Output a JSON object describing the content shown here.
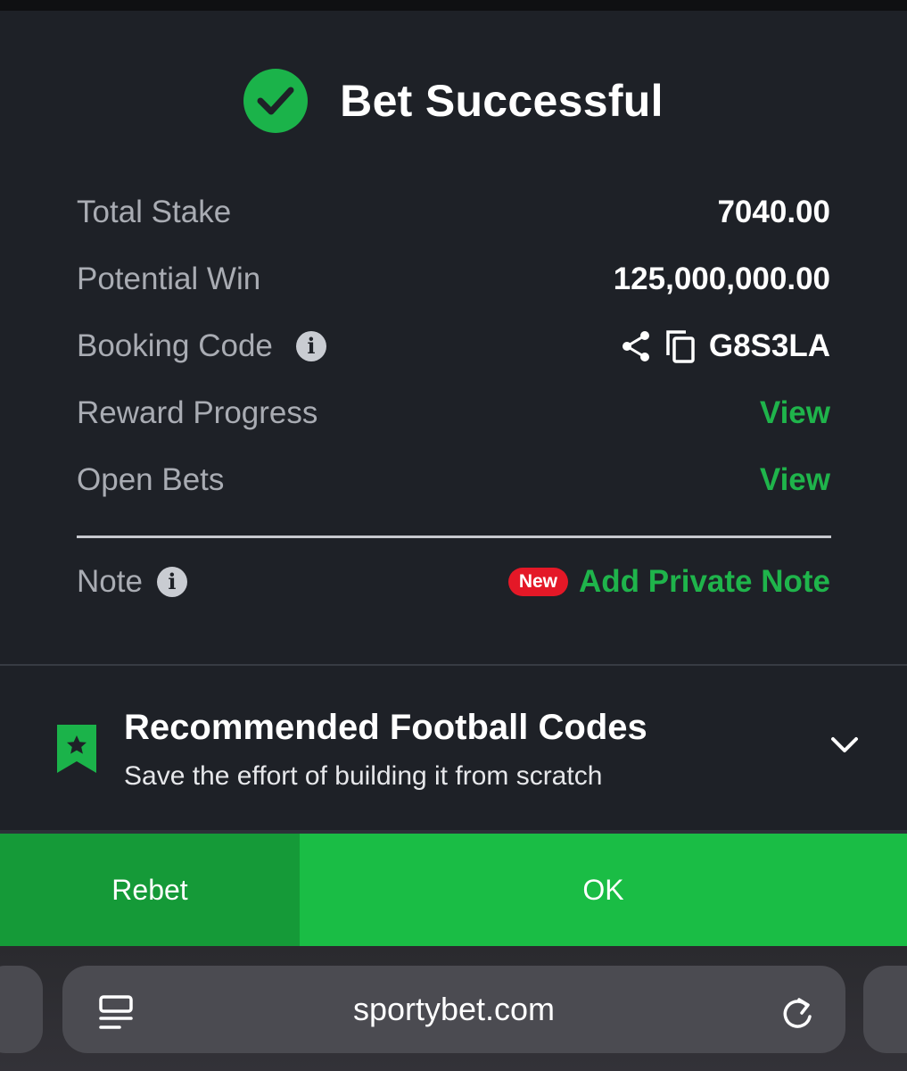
{
  "dialog": {
    "title": "Bet Successful",
    "rows": {
      "total_stake": {
        "label": "Total Stake",
        "value": "7040.00"
      },
      "potential_win": {
        "label": "Potential Win",
        "value": "125,000,000.00"
      },
      "booking_code": {
        "label": "Booking Code",
        "value": "G8S3LA"
      },
      "reward_progress": {
        "label": "Reward Progress",
        "link": "View"
      },
      "open_bets": {
        "label": "Open Bets",
        "link": "View"
      }
    },
    "note": {
      "label": "Note",
      "badge": "New",
      "link": "Add Private Note"
    },
    "info_glyph": "i"
  },
  "recommended": {
    "title": "Recommended Football Codes",
    "subtitle": "Save the effort of building it from scratch"
  },
  "actions": {
    "rebet": "Rebet",
    "ok": "OK"
  },
  "browser": {
    "url": "sportybet.com"
  },
  "colors": {
    "accent_green": "#1bb34a",
    "ok_green": "#1abd45",
    "rebet_green": "#159a38",
    "badge_red": "#e41827",
    "background": "#1e2127"
  },
  "icons": [
    "check-icon",
    "info-icon",
    "share-icon",
    "copy-icon",
    "bookmark-star-icon",
    "chevron-down-icon",
    "tabs-icon",
    "reload-icon"
  ]
}
